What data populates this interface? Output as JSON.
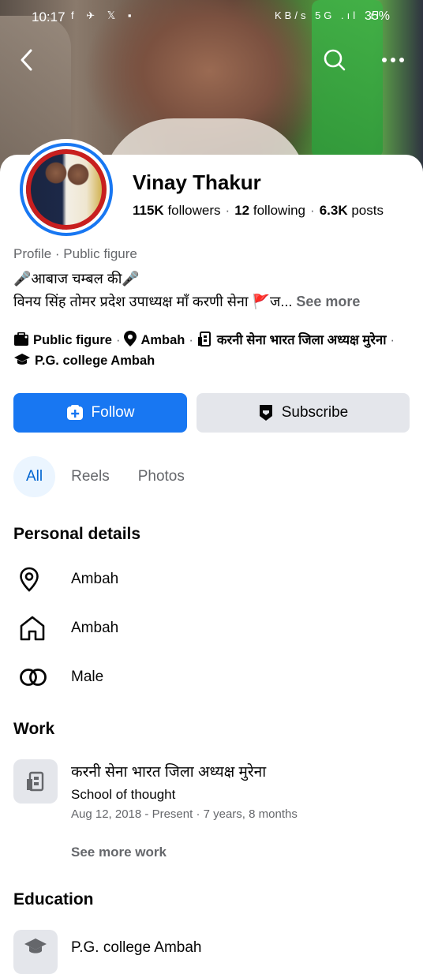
{
  "status_bar": {
    "time": "10:17",
    "left_icons": "f ✈ 𝕏 ▪",
    "right_icons": "KB/s 5G .ıl .ıl",
    "battery": "35%"
  },
  "header_icons": {
    "back": "back-arrow-icon",
    "search": "search-icon",
    "more": "more-dots-icon"
  },
  "profile": {
    "name": "Vinay Thakur",
    "followers_count": "115K",
    "followers_label": "followers",
    "following_count": "12",
    "following_label": "following",
    "posts_count": "6.3K",
    "posts_label": "posts",
    "category": "Profile · Public figure",
    "bio_line1": "🎤आबाज चम्बल की🎤",
    "bio_line2": "विनय सिंह तोमर प्रदेश उपाध्यक्ष माँ करणी सेना 🚩ज...",
    "see_more": "See more"
  },
  "intro": {
    "public_figure": "Public figure",
    "location": "Ambah",
    "workplace": "करनी सेना भारत  जिला अध्यक्ष मुरेना",
    "college": "P.G. college Ambah"
  },
  "actions": {
    "follow": "Follow",
    "subscribe": "Subscribe"
  },
  "colors": {
    "accent": "#1877f2",
    "tab_active_bg": "#ebf5ff",
    "secondary_bg": "#e4e6eb"
  },
  "tabs": [
    {
      "label": "All"
    },
    {
      "label": "Reels"
    },
    {
      "label": "Photos"
    }
  ],
  "personal_details": {
    "title": "Personal details",
    "items": [
      {
        "icon": "location-pin-icon",
        "text": "Ambah"
      },
      {
        "icon": "home-icon",
        "text": "Ambah"
      },
      {
        "icon": "gender-rings-icon",
        "text": "Male"
      }
    ]
  },
  "work": {
    "title": "Work",
    "job_title": "करनी सेना भारत  जिला अध्यक्ष मुरेना",
    "subtitle": "School of thought",
    "dates": "Aug 12, 2018 - Present · 7 years, 8 months",
    "see_more": "See more work"
  },
  "education": {
    "title": "Education",
    "school": "P.G. college Ambah"
  }
}
